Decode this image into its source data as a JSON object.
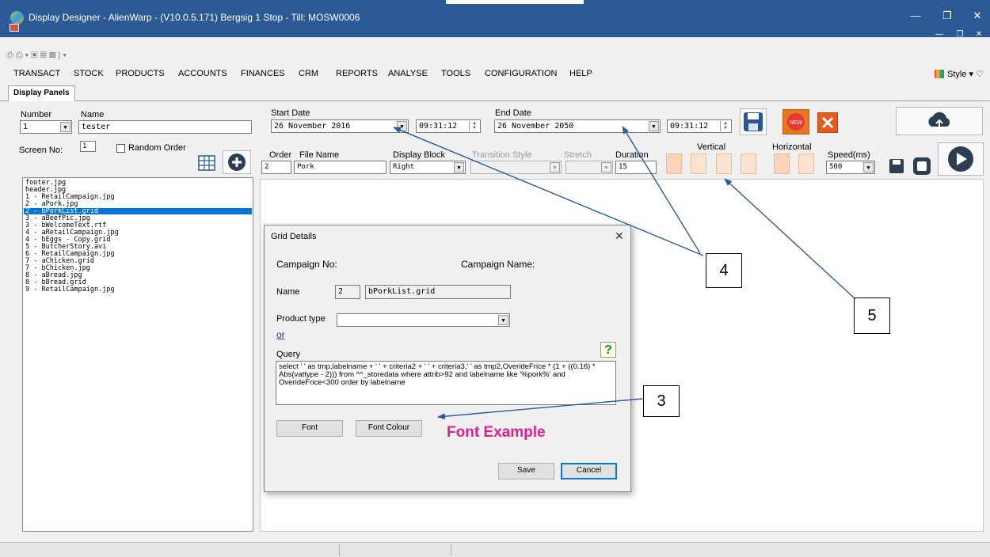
{
  "window": {
    "title": "Display Designer - AlienWarp - (V10.0.5.171) Bergsig 1 Stop - Till: MOSW0006",
    "controls": [
      "minimize",
      "restore",
      "close"
    ]
  },
  "menu": {
    "items": [
      "TRANSACT",
      "STOCK",
      "PRODUCTS",
      "ACCOUNTS",
      "FINANCES",
      "CRM",
      "REPORTS",
      "ANALYSE",
      "TOOLS",
      "CONFIGURATION",
      "HELP"
    ],
    "style_label": "Style"
  },
  "tab": {
    "label": "Display Panels"
  },
  "form": {
    "number_label": "Number",
    "number_value": "1",
    "name_label": "Name",
    "name_value": "tester",
    "screen_no_label": "Screen No:",
    "screen_no_value": "1",
    "random_order_label": "Random Order",
    "start_date_label": "Start Date",
    "start_date_value": "26 November 2016",
    "start_time_value": "09:31:12",
    "end_date_label": "End Date",
    "end_date_value": "26 November 2050",
    "end_time_value": "09:31:12",
    "order_label": "Order",
    "order_value": "2",
    "file_name_label": "File Name",
    "file_name_value": "Pork",
    "display_block_label": "Display Block",
    "display_block_value": "Right",
    "transition_style_label": "Transition Style",
    "stretch_label": "Stretch",
    "duration_label": "Duration",
    "duration_value": "15",
    "vertical_label": "Vertical",
    "horizontal_label": "Horizontal",
    "speed_label": "Speed(ms)",
    "speed_value": "500"
  },
  "file_list": [
    "footer.jpg",
    "header.jpg",
    "1 - RetailCampaign.jpg",
    "2 - aPork.jpg",
    "2 - bPorkList.grid",
    "3 - aBeefPic.jpg",
    "3 - bWelcomeText.rtf",
    "4 - aRetailCampaign.jpg",
    "4 - bEggs - Copy.grid",
    "5 -  ButcherStory.avi",
    "6 - RetailCampaign.jpg",
    "7 - aChicken.grid",
    "7 - bChicken.jpg",
    "8 - aBread.jpg",
    "8 - bBread.grid",
    "9 - RetailCampaign.jpg"
  ],
  "dialog": {
    "title": "Grid Details",
    "campaign_no_label": "Campaign No:",
    "campaign_name_label": "Campaign Name:",
    "name_label": "Name",
    "name_number": "2",
    "name_value": "bPorkList.grid",
    "product_type_label": "Product type",
    "or_label": "or",
    "query_label": "Query",
    "help_glyph": "?",
    "query_value": "select ' ' as tmp,labelname + ' ' + criteria2 + ' ' + criteria3,' ' as tmp2,OverideFrice * (1 + ((0.16) * Abs(vattype - 2))) from ^^_storedata where attrib>92 and labelname like '%pork%' and OverideFrice<300 order by labelname",
    "font_button": "Font",
    "font_colour_button": "Font Colour",
    "font_example": "Font Example",
    "save_button": "Save",
    "cancel_button": "Cancel"
  },
  "callouts": [
    "4",
    "5",
    "3"
  ],
  "colors": {
    "titlebar": "#2c5a96",
    "selection": "#0078d7",
    "font_example": "#e91e8c",
    "arrow": "#2d5a9b"
  }
}
